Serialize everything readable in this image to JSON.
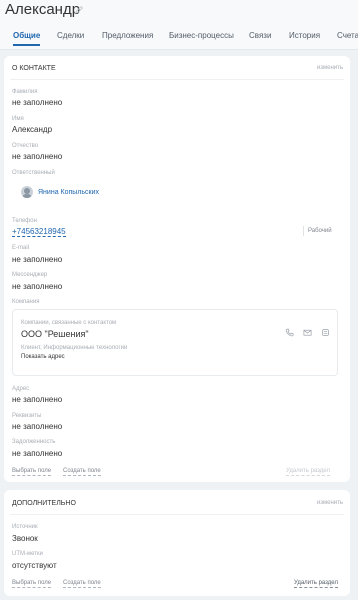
{
  "header": {
    "title": "Александр"
  },
  "tabs": [
    {
      "label": "Общие"
    },
    {
      "label": "Сделки"
    },
    {
      "label": "Предложения"
    },
    {
      "label": "Бизнес-процессы"
    },
    {
      "label": "Связи"
    },
    {
      "label": "История"
    },
    {
      "label": "Счета"
    }
  ],
  "contact_section": {
    "title": "О контакте",
    "edit_label": "изменить",
    "fields": {
      "last_name": {
        "label": "Фамилия",
        "value": "не заполнено"
      },
      "first_name": {
        "label": "Имя",
        "value": "Александр"
      },
      "middle_name": {
        "label": "Отчество",
        "value": "не заполнено"
      },
      "responsible": {
        "label": "Ответственный",
        "value": "Янина Копыльских"
      },
      "phone": {
        "label": "Телефон",
        "value": "+74563218945",
        "type": "Рабочий"
      },
      "email": {
        "label": "E-mail",
        "value": "не заполнено"
      },
      "messenger": {
        "label": "Мессенджер",
        "value": "не заполнено"
      },
      "company": {
        "label": "Компания"
      },
      "address": {
        "label": "Адрес",
        "value": "не заполнено"
      },
      "requisites": {
        "label": "Реквизиты",
        "value": "не заполнено"
      },
      "debt": {
        "label": "Задолженность",
        "value": "не заполнено"
      }
    },
    "company_card": {
      "label": "Компании, связанные с контактом",
      "name": "ООО \"Решения\"",
      "info": "Клиент, Информационные технологии",
      "address_link": "Показать адрес",
      "icons": [
        "phone-icon",
        "mail-icon",
        "chat-icon"
      ]
    },
    "footer": {
      "select_field": "Выбрать поле",
      "create_field": "Создать поле",
      "delete_section": "Удалить раздел"
    }
  },
  "additional_section": {
    "title": "Дополнительно",
    "edit_label": "изменить",
    "fields": {
      "source": {
        "label": "Источник",
        "value": "Звонок"
      },
      "utm": {
        "label": "UTM-метки",
        "value": "отсутствуют"
      }
    },
    "footer": {
      "select_field": "Выбрать поле",
      "create_field": "Создать поле",
      "delete_section": "Удалить раздел"
    }
  },
  "colors": {
    "accent": "#2067b0",
    "background": "#eef2f4",
    "muted_text": "#a8adb4"
  }
}
